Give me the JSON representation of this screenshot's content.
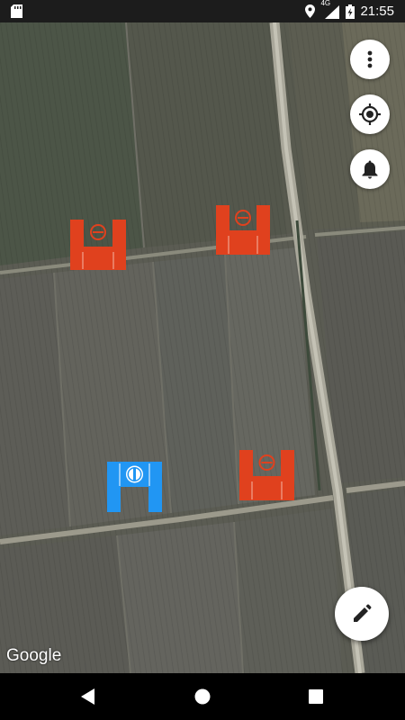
{
  "status_bar": {
    "time": "21:55",
    "network": "4G",
    "icons": [
      "sd-card-icon",
      "location-icon",
      "signal-icon",
      "battery-charging-icon"
    ]
  },
  "map": {
    "attribution": "Google",
    "markers": [
      {
        "name": "red-gate-marker",
        "color": "#e0411e"
      },
      {
        "name": "red-gate-marker",
        "color": "#e0411e"
      },
      {
        "name": "blue-gate-marker",
        "color": "#2196f3"
      },
      {
        "name": "red-gate-marker",
        "color": "#e0411e"
      }
    ]
  },
  "controls": {
    "menu_icon": "more-vert-icon",
    "location_icon": "my-location-icon",
    "alarm_icon": "bell-icon",
    "edit_icon": "pencil-icon"
  },
  "nav": {
    "icons": [
      "back-icon",
      "home-icon",
      "recents-icon"
    ]
  },
  "colors": {
    "gate_red": "#e0411e",
    "gate_blue": "#2196f3"
  }
}
